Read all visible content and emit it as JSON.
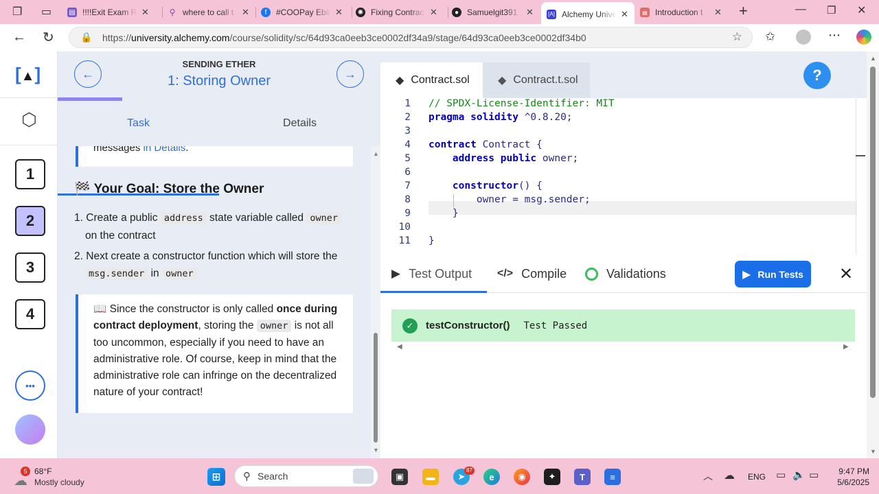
{
  "browser": {
    "tabs": [
      {
        "title": "!!!!Exit Exam Re",
        "active": false
      },
      {
        "title": "where to call t",
        "active": false
      },
      {
        "title": "#COOPay Ebir",
        "active": false
      },
      {
        "title": "Fixing Contrac",
        "active": false
      },
      {
        "title": "Samuelgit391",
        "active": false
      },
      {
        "title": "Alchemy Unive",
        "active": true
      },
      {
        "title": "Introduction t",
        "active": false
      }
    ],
    "url_prefix": "https://",
    "url_domain": "university.alchemy.com",
    "url_path": "/course/solidity/sc/64d93ca0eeb3ce0002df34a9/stage/64d93ca0eeb3ce0002df34b0",
    "accent": "#f6c4d7"
  },
  "rail": {
    "logo": "[A]",
    "steps": [
      "1",
      "2",
      "3",
      "4"
    ],
    "current_step": "2",
    "more": "•••"
  },
  "lesson": {
    "section": "SENDING ETHER",
    "title": "1: Storing Owner",
    "tabs": [
      "Task",
      "Details"
    ],
    "active_tab": "Task",
    "progress_fraction": 0.2,
    "card_top_prefix": "messages ",
    "card_top_link": "in Details",
    "card_top_suffix": ".",
    "goal_icon": "🏁",
    "goal_heading": "Your Goal: Store the Owner",
    "list": [
      {
        "num": "1.",
        "a": "Create a public ",
        "code1": "address",
        "b": " state variable called ",
        "code2": "owner",
        "c": "on the contract"
      },
      {
        "num": "2.",
        "a": "Next create a constructor function which will store the",
        "code1": "msg.sender",
        "b": " in ",
        "code2": "owner",
        "c": ""
      }
    ],
    "note_icon": "📖",
    "note": {
      "p1": " Since the constructor is only called ",
      "b1": "once during contract deployment",
      "p2": ", storing the ",
      "code": "owner",
      "p3": " is not all too uncommon, especially if you need to have an administrative role. Of course, keep in mind that the administrative role can infringe on the decentralized nature of your contract!"
    }
  },
  "editor": {
    "tabs": [
      "Contract.sol",
      "Contract.t.sol"
    ],
    "active_tab": "Contract.sol",
    "help": "?",
    "line_numbers": [
      "1",
      "2",
      "3",
      "4",
      "5",
      "6",
      "7",
      "8",
      "9",
      "10",
      "11"
    ],
    "output_tabs": [
      "Test Output",
      "Compile",
      "Validations"
    ],
    "run_button": "Run Tests",
    "result_name": "testConstructor()",
    "result_status": "Test Passed",
    "success_color": "#c8f3cf",
    "primary_color": "#1a6ee8"
  },
  "taskbar": {
    "weather_temp": "68°F",
    "weather_desc": "Mostly cloudy",
    "weather_badge": "5",
    "search_placeholder": "Search",
    "telegram_badge": "87",
    "lang": "ENG",
    "time": "9:47 PM",
    "date": "5/6/2025"
  }
}
